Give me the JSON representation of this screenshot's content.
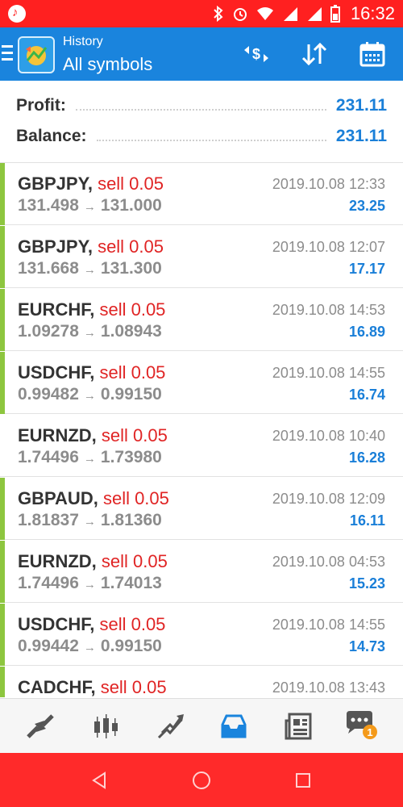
{
  "status_bar": {
    "time": "16:32",
    "icons": [
      "music-icon",
      "bluetooth-icon",
      "alarm-icon",
      "wifi-icon",
      "signal-icon",
      "signal-icon",
      "battery-icon"
    ],
    "color": "#ff2020"
  },
  "app_bar": {
    "title": "History",
    "subtitle": "All symbols",
    "color": "#1a84dd",
    "actions": [
      "currency-swap-icon",
      "sort-icon",
      "calendar-icon"
    ]
  },
  "summary": {
    "profit_label": "Profit:",
    "profit_value": "231.11",
    "balance_label": "Balance:",
    "balance_value": "231.11"
  },
  "trades": [
    {
      "symbol": "GBPJPY,",
      "side": "sell 0.05",
      "open": "131.498",
      "close": "131.000",
      "datetime": "2019.10.08 12:33",
      "profit": "23.25",
      "indicator": true
    },
    {
      "symbol": "GBPJPY,",
      "side": "sell 0.05",
      "open": "131.668",
      "close": "131.300",
      "datetime": "2019.10.08 12:07",
      "profit": "17.17",
      "indicator": true
    },
    {
      "symbol": "EURCHF,",
      "side": "sell 0.05",
      "open": "1.09278",
      "close": "1.08943",
      "datetime": "2019.10.08 14:53",
      "profit": "16.89",
      "indicator": true
    },
    {
      "symbol": "USDCHF,",
      "side": "sell 0.05",
      "open": "0.99482",
      "close": "0.99150",
      "datetime": "2019.10.08 14:55",
      "profit": "16.74",
      "indicator": true
    },
    {
      "symbol": "EURNZD,",
      "side": "sell 0.05",
      "open": "1.74496",
      "close": "1.73980",
      "datetime": "2019.10.08 10:40",
      "profit": "16.28",
      "indicator": false
    },
    {
      "symbol": "GBPAUD,",
      "side": "sell 0.05",
      "open": "1.81837",
      "close": "1.81360",
      "datetime": "2019.10.08 12:09",
      "profit": "16.11",
      "indicator": true
    },
    {
      "symbol": "EURNZD,",
      "side": "sell 0.05",
      "open": "1.74496",
      "close": "1.74013",
      "datetime": "2019.10.08 04:53",
      "profit": "15.23",
      "indicator": true
    },
    {
      "symbol": "USDCHF,",
      "side": "sell 0.05",
      "open": "0.99442",
      "close": "0.99150",
      "datetime": "2019.10.08 14:55",
      "profit": "14.73",
      "indicator": true
    },
    {
      "symbol": "CADCHF,",
      "side": "sell 0.05",
      "open": "",
      "close": "",
      "datetime": "2019.10.08 13:43",
      "profit": "",
      "indicator": true
    }
  ],
  "colors": {
    "profit_blue": "#1a7fd8",
    "sell_red": "#e02424",
    "indicator_green": "#8dc63f"
  },
  "bottom_nav": {
    "items": [
      "quotes-icon",
      "chart-icon",
      "trade-icon",
      "history-icon",
      "news-icon",
      "chat-icon"
    ],
    "active": "history-icon",
    "chat_badge": "1"
  },
  "system_nav": [
    "back-icon",
    "home-icon",
    "recents-icon"
  ]
}
